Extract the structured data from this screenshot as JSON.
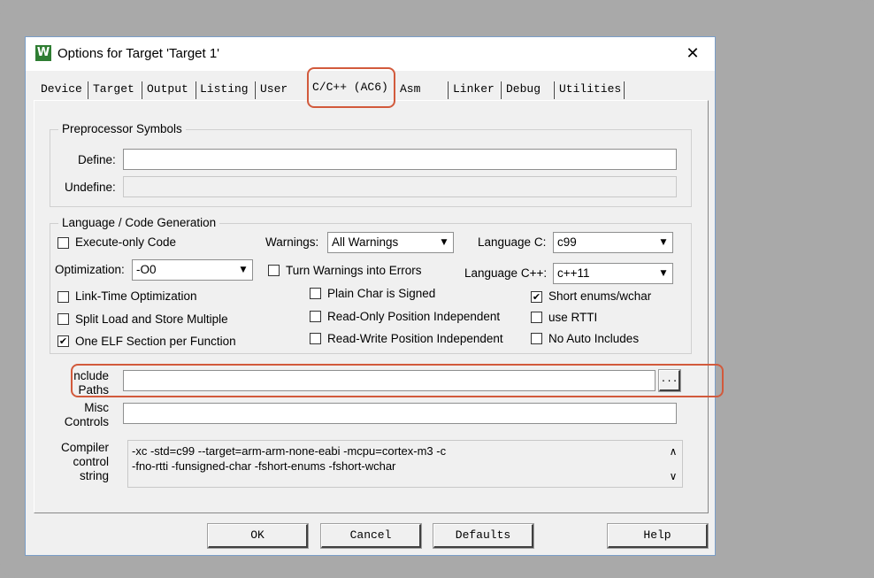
{
  "window": {
    "title": "Options for Target 'Target 1'",
    "close_glyph": "✕",
    "app_icon_glyph": "W"
  },
  "tabs": [
    {
      "label": "Device"
    },
    {
      "label": "Target"
    },
    {
      "label": "Output"
    },
    {
      "label": "Listing"
    },
    {
      "label": "User"
    },
    {
      "label": "C/C++ (AC6)",
      "active": true
    },
    {
      "label": "Asm"
    },
    {
      "label": "Linker"
    },
    {
      "label": "Debug"
    },
    {
      "label": "Utilities"
    }
  ],
  "preprocessor": {
    "group_label": "Preprocessor Symbols",
    "define_label": "Define:",
    "define_value": "",
    "undefine_label": "Undefine:",
    "undefine_value": ""
  },
  "language": {
    "group_label": "Language / Code Generation",
    "execute_only": {
      "label": "Execute-only Code",
      "checked": false
    },
    "warnings_label": "Warnings:",
    "warnings_value": "All Warnings",
    "language_c_label": "Language C:",
    "language_c_value": "c99",
    "optimization_label": "Optimization:",
    "optimization_value": "-O0",
    "turn_warnings_errors": {
      "label": "Turn Warnings into Errors",
      "checked": false
    },
    "language_cpp_label": "Language C++:",
    "language_cpp_value": "c++11",
    "link_time": {
      "label": "Link-Time Optimization",
      "checked": false
    },
    "plain_char": {
      "label": "Plain Char is Signed",
      "checked": false
    },
    "short_enums": {
      "label": "Short enums/wchar",
      "checked": true
    },
    "split_load": {
      "label": "Split Load and Store Multiple",
      "checked": false
    },
    "read_only_pi": {
      "label": "Read-Only Position Independent",
      "checked": false
    },
    "use_rtti": {
      "label": "use RTTI",
      "checked": false
    },
    "one_elf": {
      "label": "One ELF Section per Function",
      "checked": true
    },
    "read_write_pi": {
      "label": "Read-Write Position Independent",
      "checked": false
    },
    "no_auto_includes": {
      "label": "No Auto Includes",
      "checked": false
    }
  },
  "include_paths": {
    "label_line1": "Include",
    "label_line2": "Paths",
    "value": "",
    "browse_label": "..."
  },
  "misc_controls": {
    "label_line1": "Misc",
    "label_line2": "Controls",
    "value": ""
  },
  "compiler_control": {
    "label_line1": "Compiler",
    "label_line2": "control",
    "label_line3": "string",
    "line1": "-xc -std=c99 --target=arm-arm-none-eabi -mcpu=cortex-m3 -c",
    "line2": "-fno-rtti -funsigned-char -fshort-enums -fshort-wchar"
  },
  "buttons": {
    "ok": "OK",
    "cancel": "Cancel",
    "defaults": "Defaults",
    "help": "Help"
  },
  "glyphs": {
    "check": "✔",
    "dropdown": "▼",
    "scroll_up": "∧",
    "scroll_down": "∨"
  },
  "colors": {
    "annotation": "#d25a3c",
    "dialog_bg": "#f0f0f0",
    "backdrop": "#a9a9a9"
  }
}
